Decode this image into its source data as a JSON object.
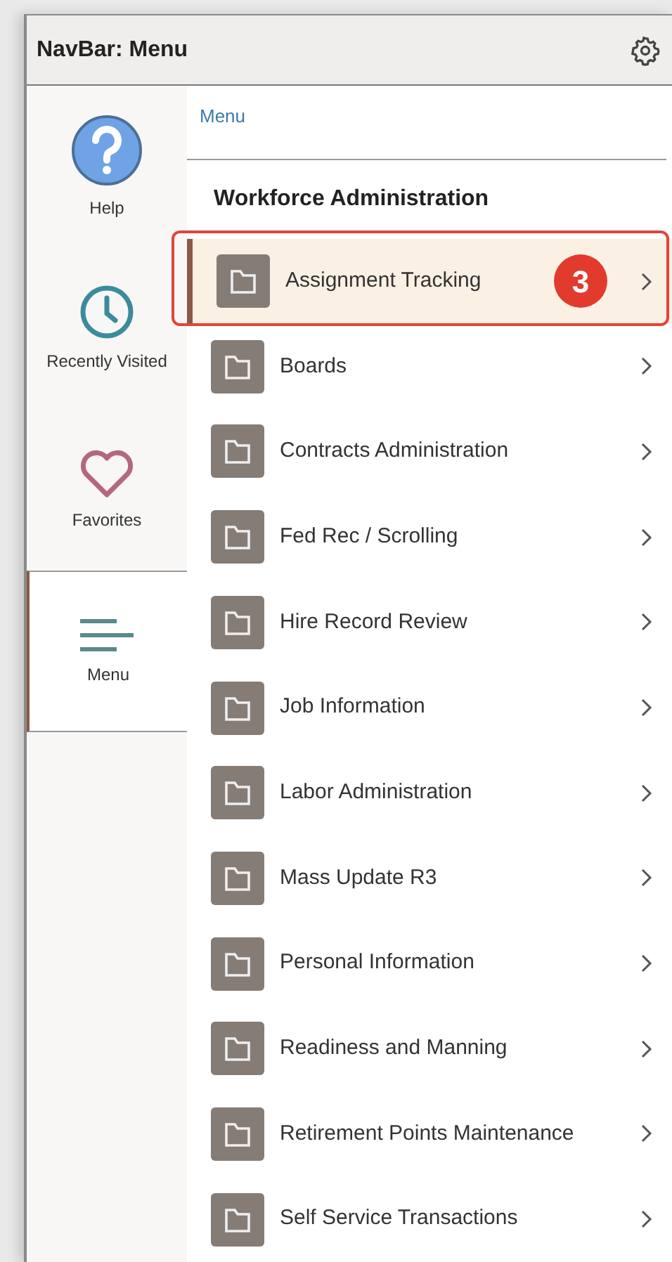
{
  "window": {
    "title": "NavBar: Menu"
  },
  "sidebar": {
    "items": [
      {
        "label": "Help",
        "kind": "help",
        "selected": false
      },
      {
        "label": "Recently Visited",
        "kind": "recent",
        "selected": false
      },
      {
        "label": "Favorites",
        "kind": "favorites",
        "selected": false
      },
      {
        "label": "Menu",
        "kind": "menu",
        "selected": true
      }
    ]
  },
  "breadcrumb": "Menu",
  "section_title": "Workforce Administration",
  "items": [
    {
      "label": "Assignment Tracking",
      "selected": true,
      "callout": "3"
    },
    {
      "label": "Boards",
      "selected": false
    },
    {
      "label": "Contracts Administration",
      "selected": false
    },
    {
      "label": "Fed Rec / Scrolling",
      "selected": false
    },
    {
      "label": "Hire Record Review",
      "selected": false
    },
    {
      "label": "Job Information",
      "selected": false
    },
    {
      "label": "Labor Administration",
      "selected": false
    },
    {
      "label": "Mass Update R3",
      "selected": false
    },
    {
      "label": "Personal Information",
      "selected": false
    },
    {
      "label": "Readiness and Manning",
      "selected": false
    },
    {
      "label": "Retirement Points Maintenance",
      "selected": false
    },
    {
      "label": "Self Service Transactions",
      "selected": false
    }
  ]
}
